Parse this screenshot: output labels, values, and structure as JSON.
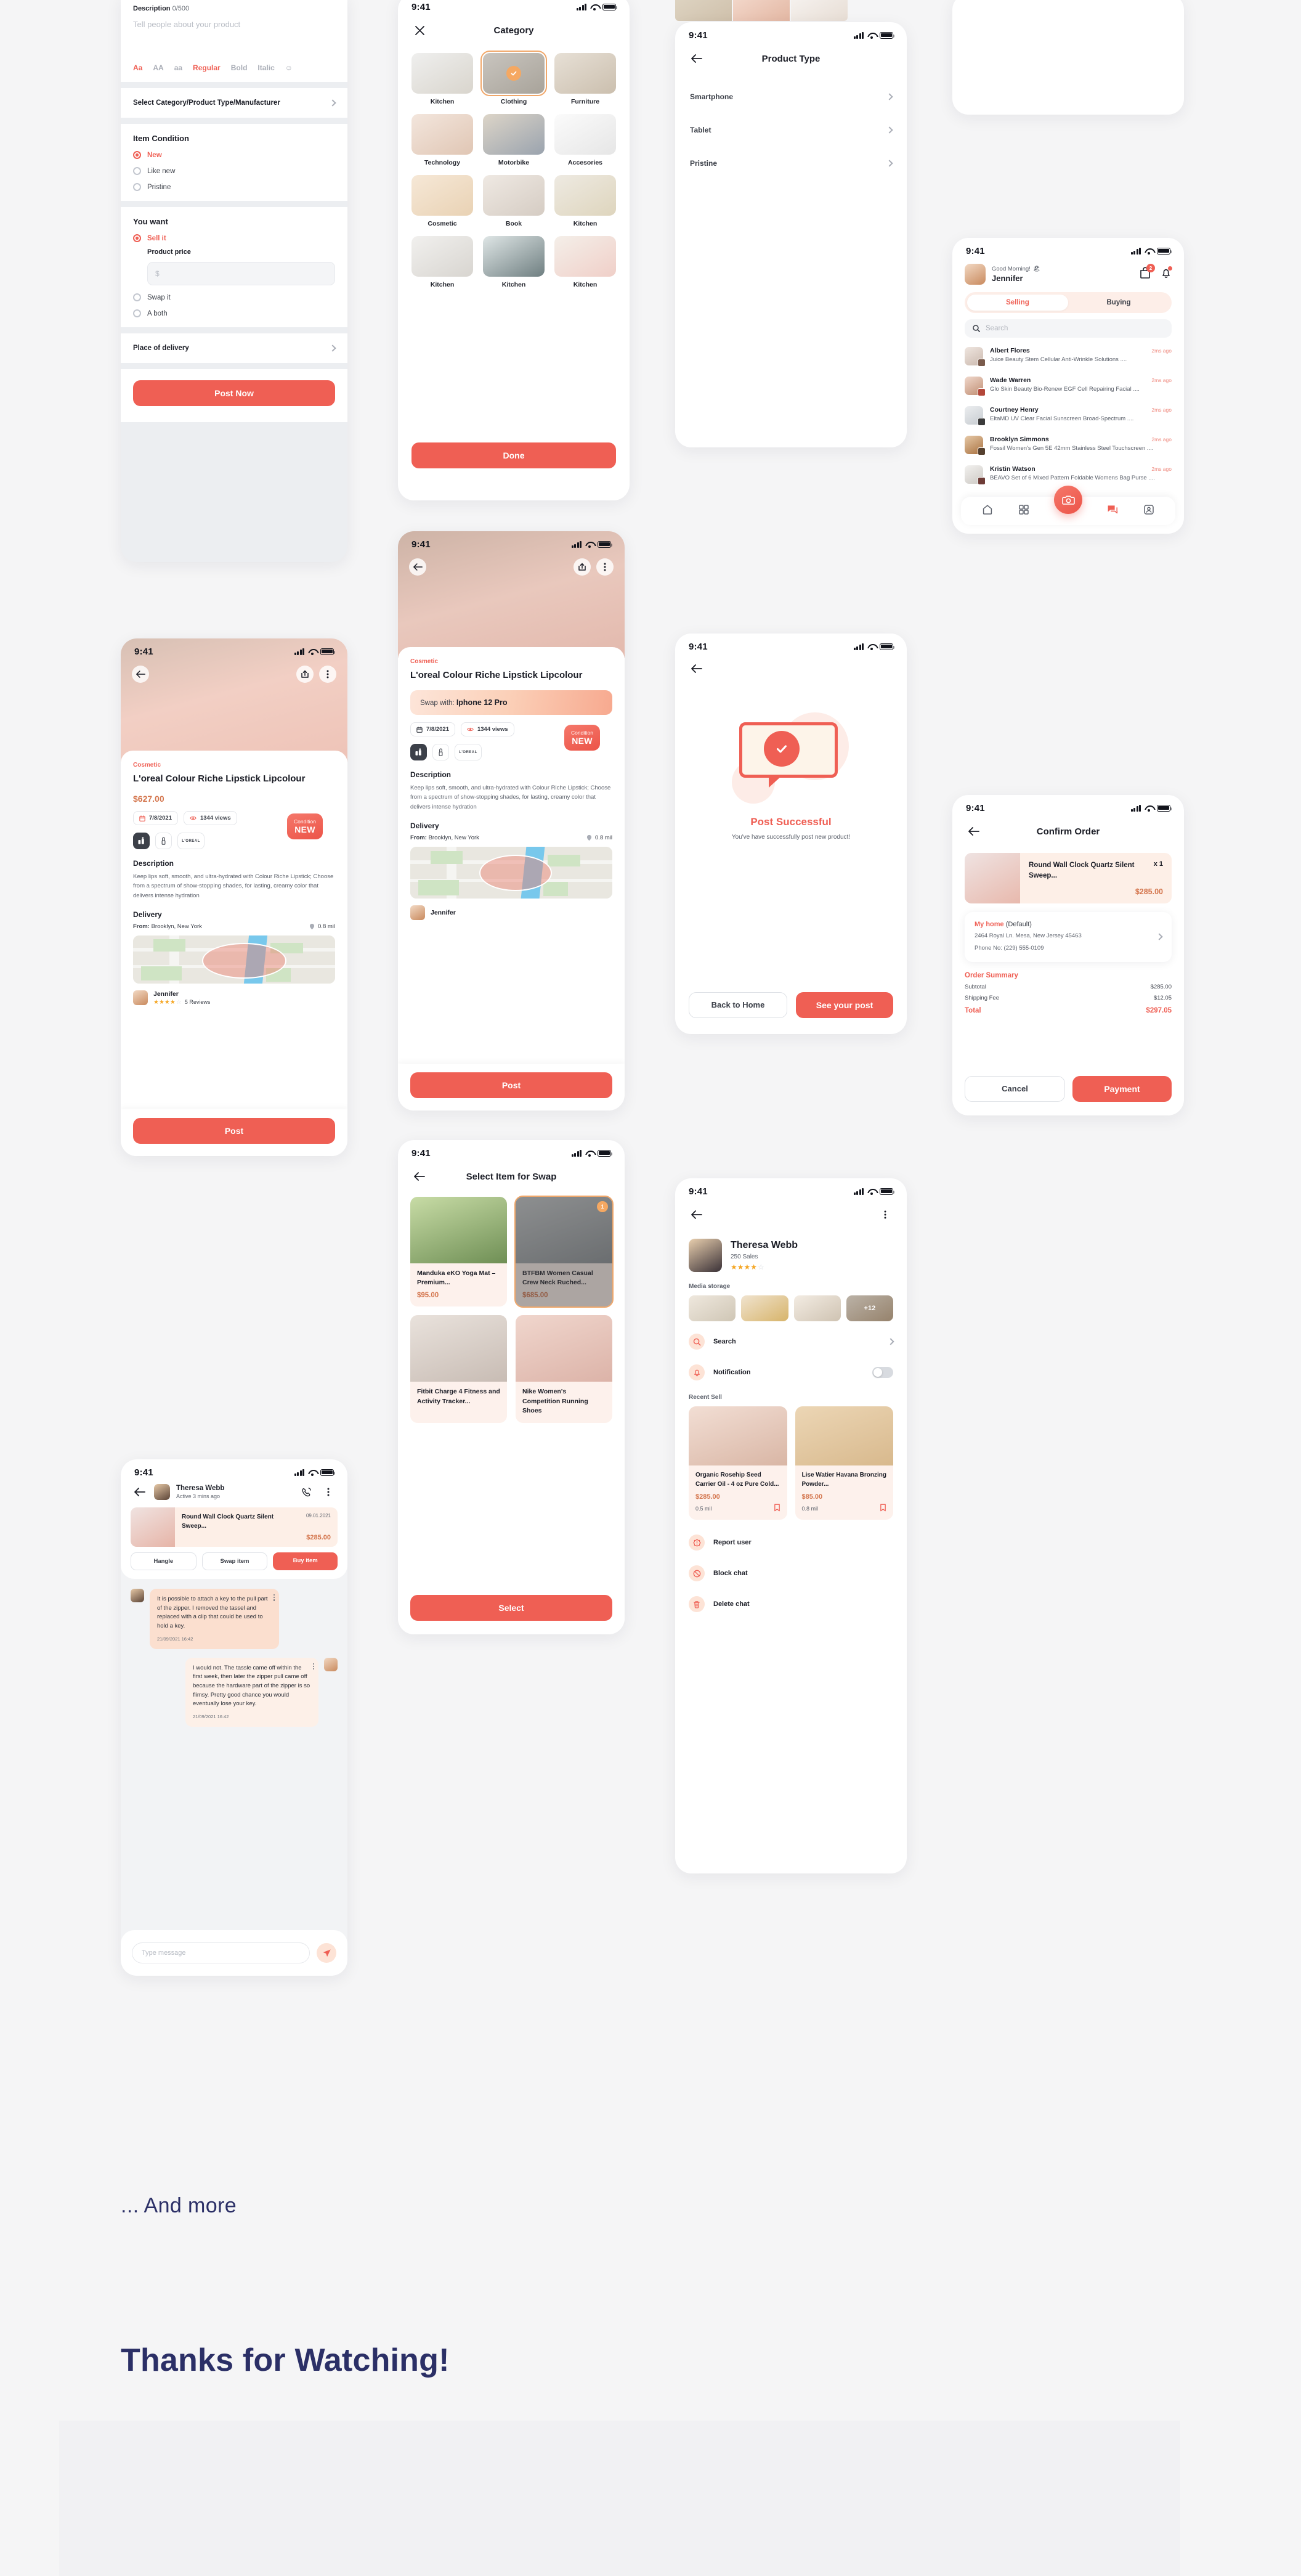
{
  "status_bar": {
    "time": "9:41"
  },
  "colors": {
    "accent": "#ef5f54",
    "price": "#d4764e",
    "selected_outline": "#f0a76a",
    "footer_text": "#2b2f66"
  },
  "post_form": {
    "description_label": "Description",
    "description_counter": "0/500",
    "description_placeholder": "Tell people about your product",
    "format_tools": [
      "Aa",
      "AA",
      "aa",
      "Regular",
      "Bold",
      "Italic",
      "emoji-icon"
    ],
    "select_category_row": "Select Category/Product Type/Manufacturer",
    "item_condition_label": "Item Condition",
    "item_condition_options": [
      "New",
      "Like new",
      "Pristine"
    ],
    "item_condition_selected": "New",
    "you_want_label": "You want",
    "you_want_options": [
      "Sell it",
      "Swap it",
      "A both"
    ],
    "you_want_selected": "Sell it",
    "product_price_label": "Product price",
    "product_price_placeholder": "$",
    "place_of_delivery_row": "Place of delivery",
    "post_now_button": "Post Now"
  },
  "category_screen": {
    "title": "Category",
    "close_icon": "close-icon",
    "items": [
      {
        "label": "Kitchen",
        "selected": false
      },
      {
        "label": "Clothing",
        "selected": true
      },
      {
        "label": "Furniture",
        "selected": false
      },
      {
        "label": "Technology",
        "selected": false
      },
      {
        "label": "Motorbike",
        "selected": false
      },
      {
        "label": "Accesories",
        "selected": false
      },
      {
        "label": "Cosmetic",
        "selected": false
      },
      {
        "label": "Book",
        "selected": false
      },
      {
        "label": "Kitchen",
        "selected": false
      },
      {
        "label": "Kitchen",
        "selected": false
      },
      {
        "label": "Kitchen",
        "selected": false
      },
      {
        "label": "Kitchen",
        "selected": false
      }
    ],
    "done_button": "Done"
  },
  "product_type_screen": {
    "title": "Product Type",
    "rows": [
      "Smartphone",
      "Tablet",
      "Pristine"
    ]
  },
  "home_feed": {
    "greeting": "Good Morning!",
    "greeting_emoji": "🏖",
    "user_name": "Jennifer",
    "cart_badge": "2",
    "tabs": [
      "Selling",
      "Buying"
    ],
    "tab_selected": "Selling",
    "search_placeholder": "Search",
    "items": [
      {
        "name": "Albert Flores",
        "time": "2ms ago",
        "desc": "Juice Beauty Stem Cellular Anti-Wrinkle Solutions ...."
      },
      {
        "name": "Wade Warren",
        "time": "2ms ago",
        "desc": "Glo Skin Beauty Bio-Renew EGF Cell Repairing Facial ...."
      },
      {
        "name": "Courtney Henry",
        "time": "2ms ago",
        "desc": "EltaMD UV Clear Facial Sunscreen Broad-Spectrum ...."
      },
      {
        "name": "Brooklyn Simmons",
        "time": "2ms ago",
        "desc": "Fossil Women's Gen 5E 42mm Stainless Steel Touchscreen ...."
      },
      {
        "name": "Kristin Watson",
        "time": "2ms ago",
        "desc": "BEAVO Set of 6 Mixed Pattern Foldable Womens Bag Purse ...."
      }
    ],
    "tabbar_icons": [
      "home-icon",
      "grid-icon",
      "camera-icon",
      "chat-icon",
      "profile-icon"
    ]
  },
  "confirm_order": {
    "title": "Confirm Order",
    "item_name": "Round Wall Clock Quartz Silent Sweep...",
    "item_qty": "x 1",
    "item_price": "$285.00",
    "address_title": "My home",
    "address_default": "(Default)",
    "address_line": "2464 Royal Ln. Mesa, New Jersey 45463",
    "phone_line": "Phone No: (229) 555-0109",
    "summary_title": "Order Summary",
    "summary_rows": [
      {
        "label": "Subtotal",
        "value": "$285.00"
      },
      {
        "label": "Shipping Fee",
        "value": "$12.05"
      }
    ],
    "total_label": "Total",
    "total_value": "$297.05",
    "cancel_button": "Cancel",
    "payment_button": "Payment"
  },
  "product_detail": {
    "category": "Cosmetic",
    "title": "L'oreal Colour Riche Lipstick Lipcolour",
    "price": "$627.00",
    "date": "7/8/2021",
    "views": "1344 views",
    "brand_chip": "L'OREAL",
    "condition_label": "Condition",
    "condition_value": "NEW",
    "description_heading": "Description",
    "description_text": "Keep lips soft, smooth, and ultra-hydrated with Colour Riche Lipstick; Choose from a spectrum of show-stopping shades, for lasting, creamy color that delivers intense hydration",
    "delivery_heading": "Delivery",
    "from_label": "From:",
    "from_value": "Brooklyn, New York",
    "distance": "0.8 mil",
    "seller_name": "Jennifer",
    "seller_reviews": "5 Reviews",
    "seller_rating": 4,
    "post_button": "Post"
  },
  "swap_detail": {
    "category": "Cosmetic",
    "title": "L'oreal Colour Riche Lipstick Lipcolour",
    "swap_with_label": "Swap with:",
    "swap_with_value": "Iphone 12 Pro",
    "date": "7/8/2021",
    "views": "1344 views",
    "brand_chip": "L'OREAL",
    "condition_label": "Condition",
    "condition_value": "NEW",
    "description_heading": "Description",
    "description_text": "Keep lips soft, smooth, and ultra-hydrated with Colour Riche Lipstick; Choose from a spectrum of show-stopping shades, for lasting, creamy color that delivers intense hydration",
    "delivery_heading": "Delivery",
    "from_label": "From:",
    "from_value": "Brooklyn, New York",
    "distance": "0.8 mil",
    "seller_name": "Jennifer",
    "post_button": "Post"
  },
  "post_success": {
    "title": "Post Successful",
    "subtitle": "You've have successfully post new product!",
    "back_button": "Back to Home",
    "see_post_button": "See your post"
  },
  "select_swap": {
    "title": "Select Item for Swap",
    "items": [
      {
        "name": "Manduka eKO Yoga Mat – Premium...",
        "price": "$95.00",
        "selected": false,
        "badge": ""
      },
      {
        "name": "BTFBM Women Casual Crew Neck Ruched...",
        "price": "$685.00",
        "selected": true,
        "badge": "1"
      },
      {
        "name": "Fitbit Charge 4 Fitness and Activity Tracker...",
        "price": "",
        "selected": false,
        "badge": ""
      },
      {
        "name": "Nike Women's Competition Running Shoes",
        "price": "",
        "selected": false,
        "badge": ""
      }
    ],
    "select_button": "Select"
  },
  "chat": {
    "partner_name": "Theresa Webb",
    "partner_status": "Active 3 mins ago",
    "item_name": "Round Wall Clock Quartz Silent Sweep...",
    "item_date": "09.01.2021",
    "item_price": "$285.00",
    "buttons": [
      "Hangle",
      "Swap item",
      "Buy item"
    ],
    "messages": [
      {
        "side": "in",
        "text": "It is possible to attach a key to the pull part of the zipper. I removed the tassel and replaced with a clip that could be used to hold a key.",
        "time": "21/09/2021 16:42"
      },
      {
        "side": "out",
        "text": "I would not. The tassle came off within the first week, then later the zipper pull came off because the hardware part of the zipper is so flimsy. Pretty good chance you would eventually lose your key.",
        "time": "21/09/2021 16:42"
      }
    ],
    "input_placeholder": "Type message",
    "send_icon": "send-icon"
  },
  "profile": {
    "name": "Theresa Webb",
    "sales": "250 Sales",
    "rating": 4,
    "media_label": "Media storage",
    "media_more": "+12",
    "options": [
      {
        "label": "Search",
        "icon": "search-icon",
        "control": "chevron"
      },
      {
        "label": "Notification",
        "icon": "bell-icon",
        "control": "toggle"
      }
    ],
    "recent_label": "Recent Sell",
    "recent_items": [
      {
        "name": "Organic Rosehip Seed Carrier Oil - 4 oz Pure Cold...",
        "price": "$285.00",
        "distance": "0.5 mil"
      },
      {
        "name": "Lise Watier Havana Bronzing Powder...",
        "price": "$85.00",
        "distance": "0.8 mil"
      }
    ],
    "actions": [
      {
        "label": "Report user",
        "icon": "report-icon"
      },
      {
        "label": "Block chat",
        "icon": "block-icon"
      },
      {
        "label": "Delete chat",
        "icon": "trash-icon"
      }
    ]
  },
  "footer": {
    "and_more": "... And more",
    "thanks": "Thanks for Watching!"
  }
}
